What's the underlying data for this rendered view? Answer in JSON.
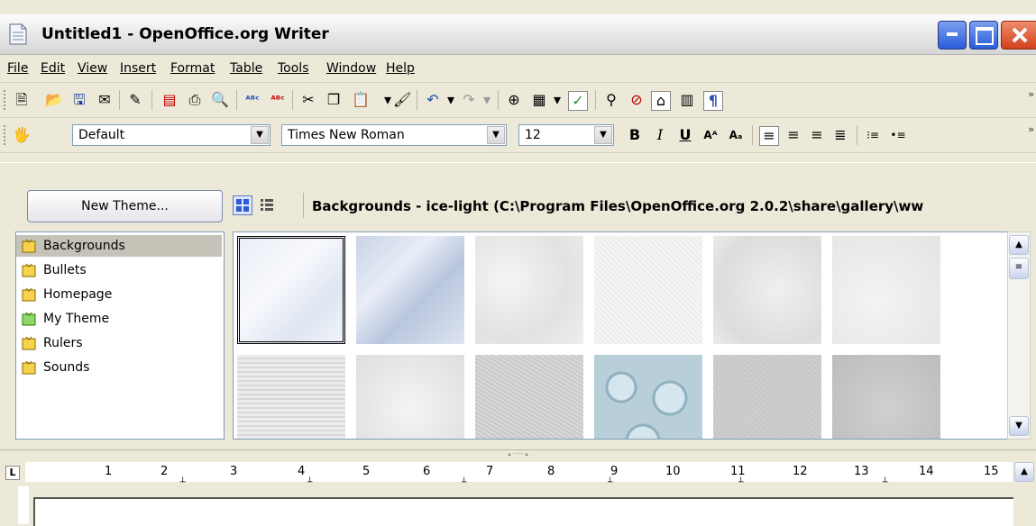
{
  "window": {
    "title": "Untitled1 - OpenOffice.org Writer"
  },
  "menu": [
    "File",
    "Edit",
    "View",
    "Insert",
    "Format",
    "Table",
    "Tools",
    "Window",
    "Help"
  ],
  "format_toolbar": {
    "style": "Default",
    "font": "Times New Roman",
    "size": "12"
  },
  "gallery": {
    "new_theme_label": "New Theme...",
    "path": "Backgrounds - ice-light (C:\\Program Files\\OpenOffice.org 2.0.2\\share\\gallery\\ww",
    "themes": [
      "Backgrounds",
      "Bullets",
      "Homepage",
      "My Theme",
      "Rulers",
      "Sounds"
    ]
  },
  "ruler": {
    "numbers": [
      "1",
      "2",
      "3",
      "4",
      "5",
      "6",
      "7",
      "8",
      "9",
      "10",
      "11",
      "12",
      "13",
      "14",
      "15"
    ]
  },
  "colors": {
    "selection": "#c5c2b8",
    "titlebar": "#e4e4e4",
    "chrome": "#ece9d8"
  }
}
